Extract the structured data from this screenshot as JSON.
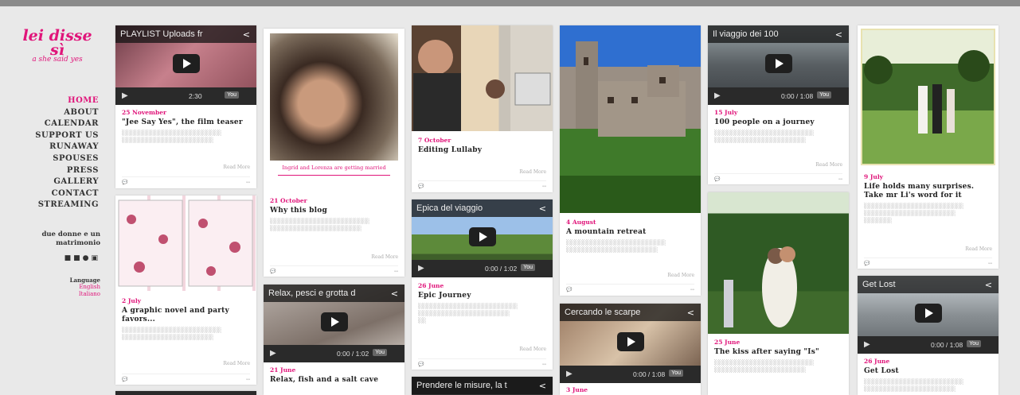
{
  "site": {
    "logo": "lei disse sì",
    "logo_sub": "a she said yes",
    "nav": [
      "HOME",
      "ABOUT",
      "CALENDAR",
      "SUPPORT US",
      "RUNAWAY",
      "SPOUSES",
      "PRESS",
      "GALLERY",
      "CONTACT",
      "STREAMING"
    ],
    "tagline_1": "due donne e un",
    "tagline_2": "matrimonio",
    "language_label": "Language",
    "lang_en": "English",
    "lang_it": "Italiano"
  },
  "videos": {
    "v1": {
      "title": "PLAYLIST  Uploads fr",
      "time": "2:30"
    },
    "v2": {
      "title": "Epica del viaggio",
      "time": "0:00 / 1:02"
    },
    "v3": {
      "title": "Relax, pesci e grotta d",
      "time": "0:00 / 1:02"
    },
    "v4": {
      "title": "Cercando le scarpe",
      "time": "0:00 / 1:08"
    },
    "v5": {
      "title": "Il viaggio dei 100",
      "time": "0:00 / 1:08"
    },
    "v6": {
      "title": "Get Lost",
      "time": "0:00 / 1:08"
    },
    "v7": {
      "title": "Prendere le misure, la t",
      "time": ""
    }
  },
  "posts": {
    "p1": {
      "date": "25 November",
      "title": "\"Jee Say Yes\", the film teaser"
    },
    "p2": {
      "date": "2 July",
      "title": "A graphic novel and party favors..."
    },
    "p3": {
      "date": "21 October",
      "title": "Why this blog",
      "caption": "Ingrid and Lorenza are getting married"
    },
    "p4": {
      "date": "21 June",
      "title": "Relax, fish and a salt cave"
    },
    "p5": {
      "date": "7 October",
      "title": "Editing Lullaby"
    },
    "p6": {
      "date": "26 June",
      "title": "Epic Journey"
    },
    "p7": {
      "date": "4 August",
      "title": "A mountain retreat"
    },
    "p8": {
      "date": "3 June",
      "title": ""
    },
    "p9": {
      "date": "15 July",
      "title": "100 people on a journey"
    },
    "p10": {
      "date": "25 June",
      "title": "The kiss after saying \"Is\""
    },
    "p11": {
      "date": "9 July",
      "title": "Life holds many surprises. Take mr Li's word for it"
    },
    "p12": {
      "date": "26 June",
      "title": "Get Lost"
    }
  },
  "read_more": "Read More",
  "colors": {
    "accent": "#e0157a",
    "background": "#e9e9e9"
  }
}
